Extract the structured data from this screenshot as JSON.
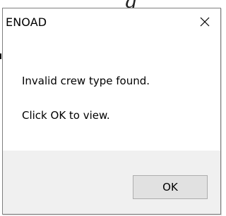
{
  "dialog": {
    "title": "ENOAD",
    "close_icon": "close-icon",
    "message_line1": "Invalid crew type found.",
    "message_line2": "Click OK to view.",
    "ok_label": "OK"
  },
  "colors": {
    "content_background": "#ffffff",
    "footer_background": "#f0f0f0",
    "button_face": "#e1e1e1",
    "button_border": "#adadad",
    "dialog_border": "#7f7f7f"
  }
}
